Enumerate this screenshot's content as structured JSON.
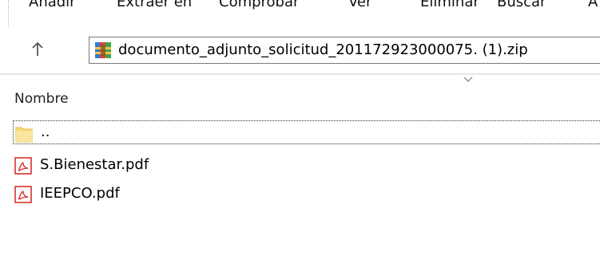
{
  "toolbar": {
    "items": [
      "Añadir",
      "Extraer en",
      "Comprobar",
      "Ver",
      "Eliminar",
      "Buscar",
      "A"
    ]
  },
  "address": {
    "path": "documento_adjunto_solicitud_201172923000075. (1).zip"
  },
  "list": {
    "column_name": "Nombre",
    "rows": [
      {
        "name": "..",
        "type": "folder"
      },
      {
        "name": "S.Bienestar.pdf",
        "type": "pdf"
      },
      {
        "name": "IEEPCO.pdf",
        "type": "pdf"
      }
    ]
  },
  "icons": {
    "up": "arrow-up-icon",
    "zip": "winrar-archive-icon",
    "folder": "folder-icon",
    "pdf": "pdf-icon",
    "sort": "chevron-down-icon"
  },
  "colors": {
    "pdf_red": "#d9322b",
    "folder_yellow": "#f8d775",
    "border": "#7a7a7a"
  }
}
